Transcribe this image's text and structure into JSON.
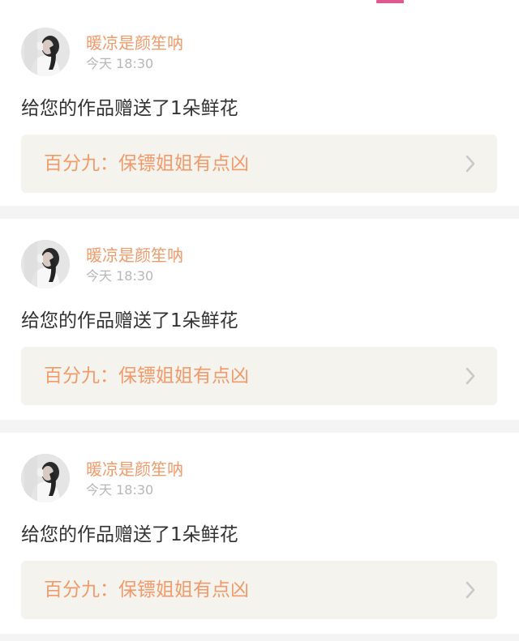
{
  "top_indicator": {
    "color": "#e0588f"
  },
  "notifications": [
    {
      "username": "暖凉是颜笙呐",
      "time": "今天 18:30",
      "message": "给您的作品赠送了1朵鲜花",
      "work_title": "百分九：保镖姐姐有点凶",
      "avatar_icon": "avatar-photo"
    },
    {
      "username": "暖凉是颜笙呐",
      "time": "今天 18:30",
      "message": "给您的作品赠送了1朵鲜花",
      "work_title": "百分九：保镖姐姐有点凶",
      "avatar_icon": "avatar-photo"
    },
    {
      "username": "暖凉是颜笙呐",
      "time": "今天 18:30",
      "message": "给您的作品赠送了1朵鲜花",
      "work_title": "百分九：保镖姐姐有点凶",
      "avatar_icon": "avatar-photo"
    }
  ],
  "colors": {
    "accent": "#f39a6b",
    "text_primary": "#333333",
    "text_secondary": "#b7b7b7",
    "card_bg": "#ffffff",
    "link_bg": "#f4f3ee",
    "page_bg": "#f4f4f4"
  },
  "icons": {
    "chevron": "chevron-right-icon"
  }
}
